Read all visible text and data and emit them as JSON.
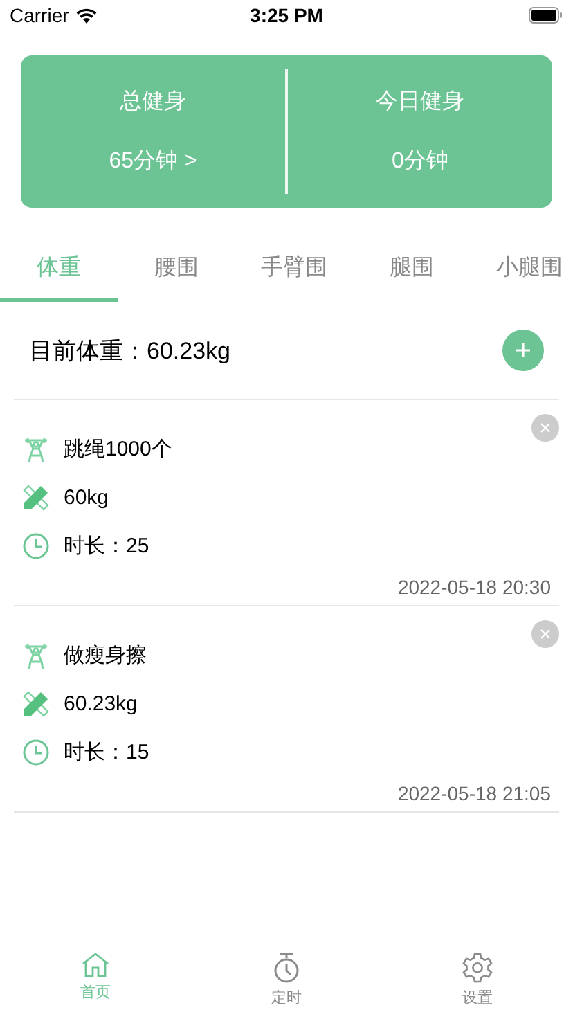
{
  "status_bar": {
    "carrier": "Carrier",
    "time": "3:25 PM"
  },
  "summary": [
    {
      "label": "总健身",
      "value": "65分钟 >"
    },
    {
      "label": "今日健身",
      "value": "0分钟"
    }
  ],
  "tabs": [
    {
      "label": "体重",
      "selected": true
    },
    {
      "label": "腰围",
      "selected": false
    },
    {
      "label": "手臂围",
      "selected": false
    },
    {
      "label": "腿围",
      "selected": false
    },
    {
      "label": "小腿围",
      "selected": false
    }
  ],
  "current": {
    "text": "目前体重：60.23kg"
  },
  "records": [
    {
      "name": "跳绳1000个",
      "weight": "60kg",
      "duration": "时长：25",
      "time": "2022-05-18 20:30"
    },
    {
      "name": "做瘦身擦",
      "weight": "60.23kg",
      "duration": "时长：15",
      "time": "2022-05-18 21:05"
    }
  ],
  "tab_bar": [
    {
      "label": "首页",
      "kind": "home",
      "selected": true
    },
    {
      "label": "定时",
      "kind": "timer",
      "selected": false
    },
    {
      "label": "设置",
      "kind": "settings",
      "selected": false
    }
  ]
}
